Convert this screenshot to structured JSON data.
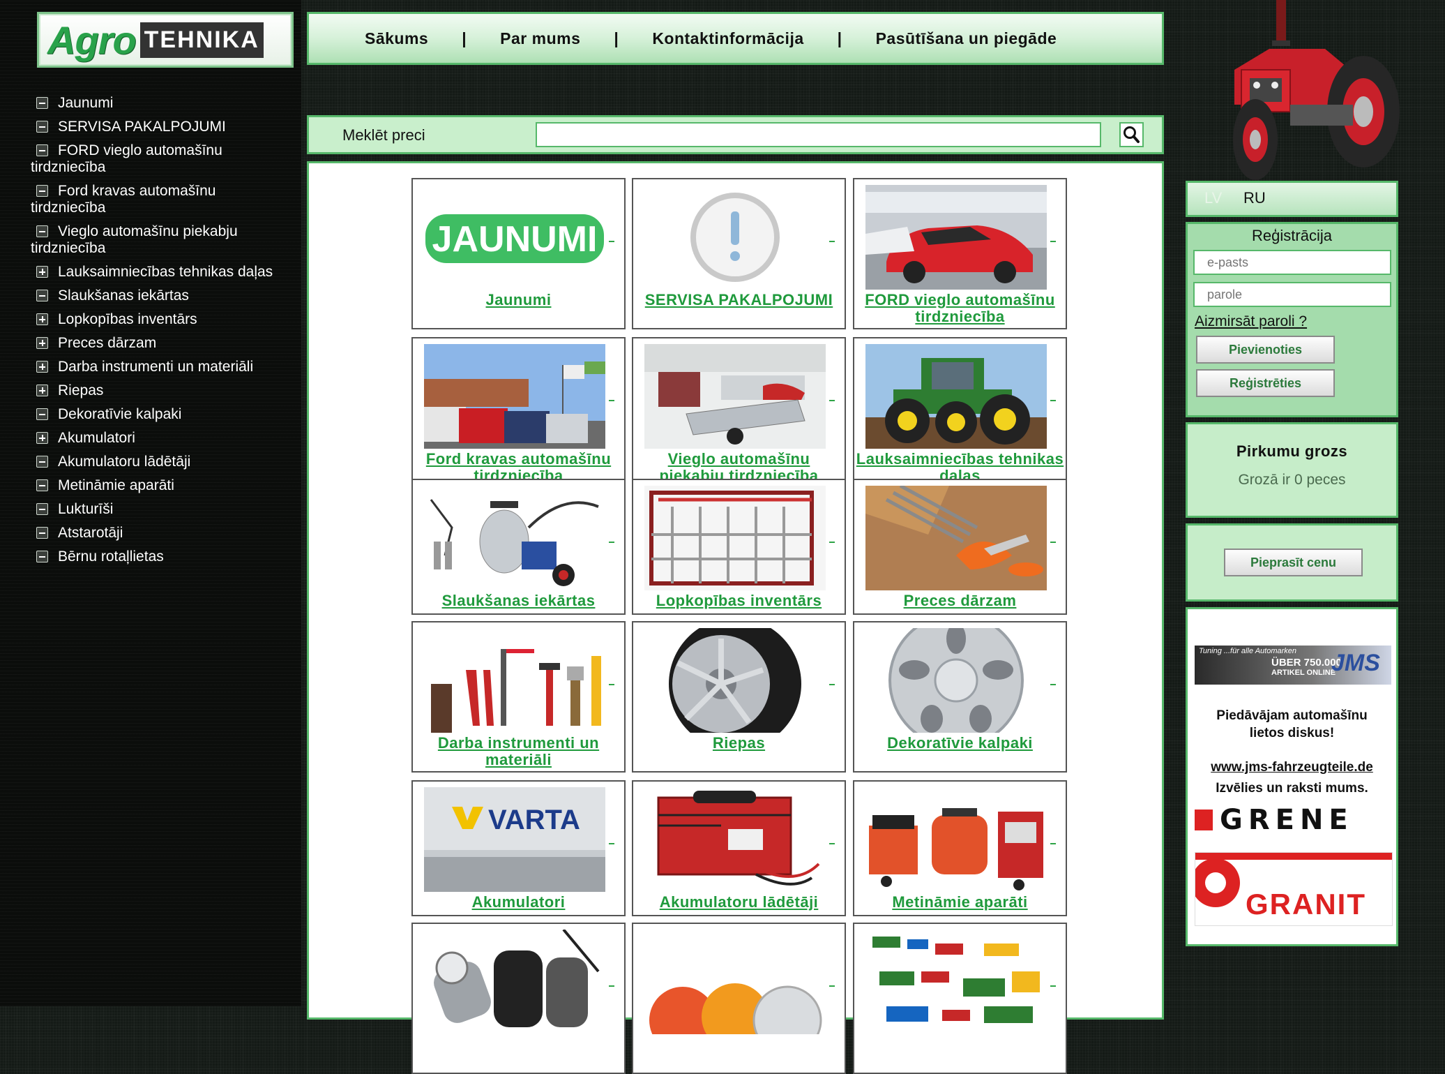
{
  "brand": {
    "logo_part1": "Agro",
    "logo_part2": "TEHNIKA"
  },
  "nav": {
    "items": [
      {
        "label": "Sākums"
      },
      {
        "label": "Par mums"
      },
      {
        "label": "Kontaktinformācija"
      },
      {
        "label": "Pasūtīšana un piegāde"
      }
    ],
    "separator": "|"
  },
  "search": {
    "label": "Meklēt preci",
    "value": ""
  },
  "sidebar": {
    "items": [
      {
        "label": "Jaunumi",
        "icon": "minus"
      },
      {
        "label": "SERVISA PAKALPOJUMI",
        "icon": "minus"
      },
      {
        "label": "FORD vieglo automašīnu tirdzniecība",
        "icon": "minus"
      },
      {
        "label": "Ford kravas automašīnu tirdzniecība",
        "icon": "minus"
      },
      {
        "label": "Vieglo automašīnu piekabju tirdzniecība",
        "icon": "minus"
      },
      {
        "label": "Lauksaimniecības tehnikas daļas",
        "icon": "plus"
      },
      {
        "label": "Slaukšanas iekārtas",
        "icon": "minus"
      },
      {
        "label": "Lopkopības inventārs",
        "icon": "plus"
      },
      {
        "label": "Preces dārzam",
        "icon": "plus"
      },
      {
        "label": "Darba instrumenti un materiāli",
        "icon": "plus"
      },
      {
        "label": "Riepas",
        "icon": "plus"
      },
      {
        "label": "Dekoratīvie kalpaki",
        "icon": "minus"
      },
      {
        "label": "Akumulatori",
        "icon": "plus"
      },
      {
        "label": "Akumulatoru lādētāji",
        "icon": "minus"
      },
      {
        "label": "Metināmie aparāti",
        "icon": "minus"
      },
      {
        "label": "Lukturīši",
        "icon": "minus"
      },
      {
        "label": "Atstarotāji",
        "icon": "minus"
      },
      {
        "label": "Bērnu rotaļlietas",
        "icon": "minus"
      }
    ]
  },
  "categories": [
    {
      "label": "Jaunumi",
      "image": "jaunumi-badge"
    },
    {
      "label": "SERVISA PAKALPOJUMI",
      "image": "exclamation-icon"
    },
    {
      "label": "FORD vieglo automašīnu tirdzniecība",
      "image": "red-car-photo"
    },
    {
      "label": "Ford kravas automašīnu tirdzniecība",
      "image": "vans-photo"
    },
    {
      "label": "Vieglo automašīnu piekabju tirdzniecība",
      "image": "trailer-photo"
    },
    {
      "label": "Lauksaimniecības tehnikas daļas",
      "image": "green-tractor-photo"
    },
    {
      "label": "Slaukšanas iekārtas",
      "image": "milking-machine-photo"
    },
    {
      "label": "Lopkopības inventārs",
      "image": "cattle-crate-photo"
    },
    {
      "label": "Preces dārzam",
      "image": "garden-tools-photo"
    },
    {
      "label": "Darba instrumenti un materiāli",
      "image": "hand-tools-photo"
    },
    {
      "label": "Riepas",
      "image": "tire-photo"
    },
    {
      "label": "Dekoratīvie kalpaki",
      "image": "hubcap-photo"
    },
    {
      "label": "Akumulatori",
      "image": "varta-battery-photo"
    },
    {
      "label": "Akumulatoru lādētāji",
      "image": "battery-charger-photo"
    },
    {
      "label": "Metināmie aparāti",
      "image": "welders-photo"
    },
    {
      "label": "",
      "image": "flashlights-photo"
    },
    {
      "label": "",
      "image": "reflectors-photo"
    },
    {
      "label": "",
      "image": "toys-photo"
    }
  ],
  "battery_brand": "VARTA",
  "jaunumi_badge": "JAUNUMI",
  "lang": {
    "lv": "LV",
    "ru": "RU"
  },
  "registration": {
    "title": "Reģistrācija",
    "email_placeholder": "e-pasts",
    "password_placeholder": "parole",
    "forgot": "Aizmirsāt paroli ?",
    "login_button": "Pievienoties",
    "register_button": "Reģistrēties"
  },
  "cart": {
    "title": "Pirkumu grozs",
    "status": "Grozā ir 0 peces"
  },
  "ask_price": {
    "button": "Pieprasīt cenu"
  },
  "ads": {
    "banner_text1": "Tuning ...für alle Automarken",
    "banner_text2": "ÜBER 750.000",
    "banner_text3": "ARTIKEL ONLINE",
    "banner_brand": "JMS",
    "offer_line1": "Piedāvājam automašīnu",
    "offer_line2": "lietos diskus!",
    "link": "www.jms-fahrzeugteile.de",
    "cta": "Izvēlies un raksti mums.",
    "logo1": "GRENE",
    "logo2": "GRANIT"
  },
  "colors": {
    "accent": "#1f9a3c",
    "box_border": "#56b86a",
    "box_bg": "#c6edc9"
  }
}
